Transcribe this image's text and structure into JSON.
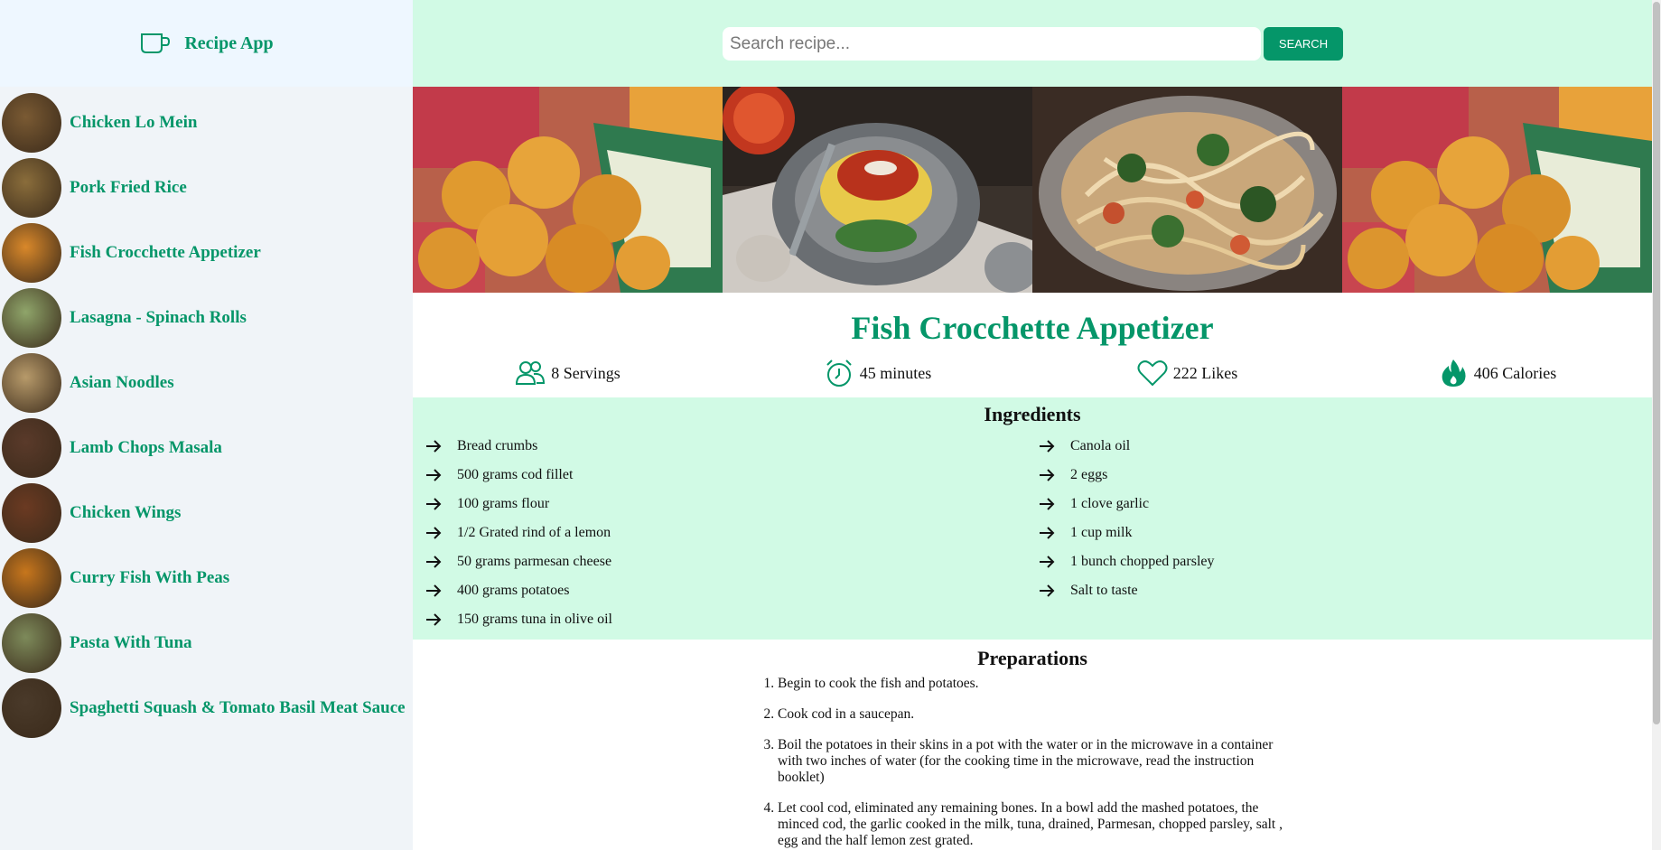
{
  "app": {
    "title": "Recipe App",
    "accent_color": "#059669",
    "logo_icon": "cup-icon"
  },
  "search": {
    "placeholder": "Search recipe...",
    "value": "",
    "button_label": "SEARCH"
  },
  "sidebar": {
    "items": [
      {
        "label": "Chicken Lo Mein",
        "thumb_color": "#7a5a33"
      },
      {
        "label": "Pork Fried Rice",
        "thumb_color": "#8a6d3b"
      },
      {
        "label": "Fish Crocchette Appetizer",
        "thumb_color": "#d9882a"
      },
      {
        "label": "Lasagna - Spinach Rolls",
        "thumb_color": "#8fa56a"
      },
      {
        "label": "Asian Noodles",
        "thumb_color": "#b79a6a"
      },
      {
        "label": "Lamb Chops Masala",
        "thumb_color": "#5a3a2a"
      },
      {
        "label": "Chicken Wings",
        "thumb_color": "#6b3a22"
      },
      {
        "label": "Curry Fish With Peas",
        "thumb_color": "#c7761c"
      },
      {
        "label": "Pasta With Tuna",
        "thumb_color": "#7d8a5a"
      },
      {
        "label": "Spaghetti Squash & Tomato Basil Meat Sauce",
        "thumb_color": "#4a3a2a"
      }
    ]
  },
  "recipe": {
    "title": "Fish Crocchette Appetizer",
    "stats": {
      "servings": "8 Servings",
      "time": "45 minutes",
      "likes": "222 Likes",
      "calories": "406 Calories"
    },
    "ingredients_heading": "Ingredients",
    "ingredients_left": [
      "Bread crumbs",
      "500 grams cod fillet",
      "100 grams flour",
      "1/2 Grated rind of a lemon",
      "50 grams parmesan cheese",
      "400 grams potatoes",
      "150 grams tuna in olive oil"
    ],
    "ingredients_right": [
      "Canola oil",
      "2 eggs",
      "1 clove garlic",
      "1 cup milk",
      "1 bunch chopped parsley",
      "Salt to taste"
    ],
    "preparations_heading": "Preparations",
    "steps": [
      "Begin to cook the fish and potatoes.",
      "Cook cod in a saucepan.",
      "Boil the potatoes in their skins in a pot with the water or in the microwave in a container with two inches of water (for the cooking time in the microwave, read the instruction booklet)",
      "Let cool cod, eliminated any remaining bones. In a bowl add the mashed potatoes, the minced cod, the garlic cooked in the milk, tuna, drained, Parmesan, chopped parsley, salt , egg and the half lemon zest grated."
    ],
    "gallery": [
      {
        "name": "gallery-image-croquettes",
        "icon": "croquettes-photo"
      },
      {
        "name": "gallery-image-spaghetti-squash",
        "icon": "spaghetti-squash-photo"
      },
      {
        "name": "gallery-image-asian-noodles",
        "icon": "noodles-photo"
      },
      {
        "name": "gallery-image-croquettes-2",
        "icon": "croquettes-photo"
      }
    ]
  }
}
